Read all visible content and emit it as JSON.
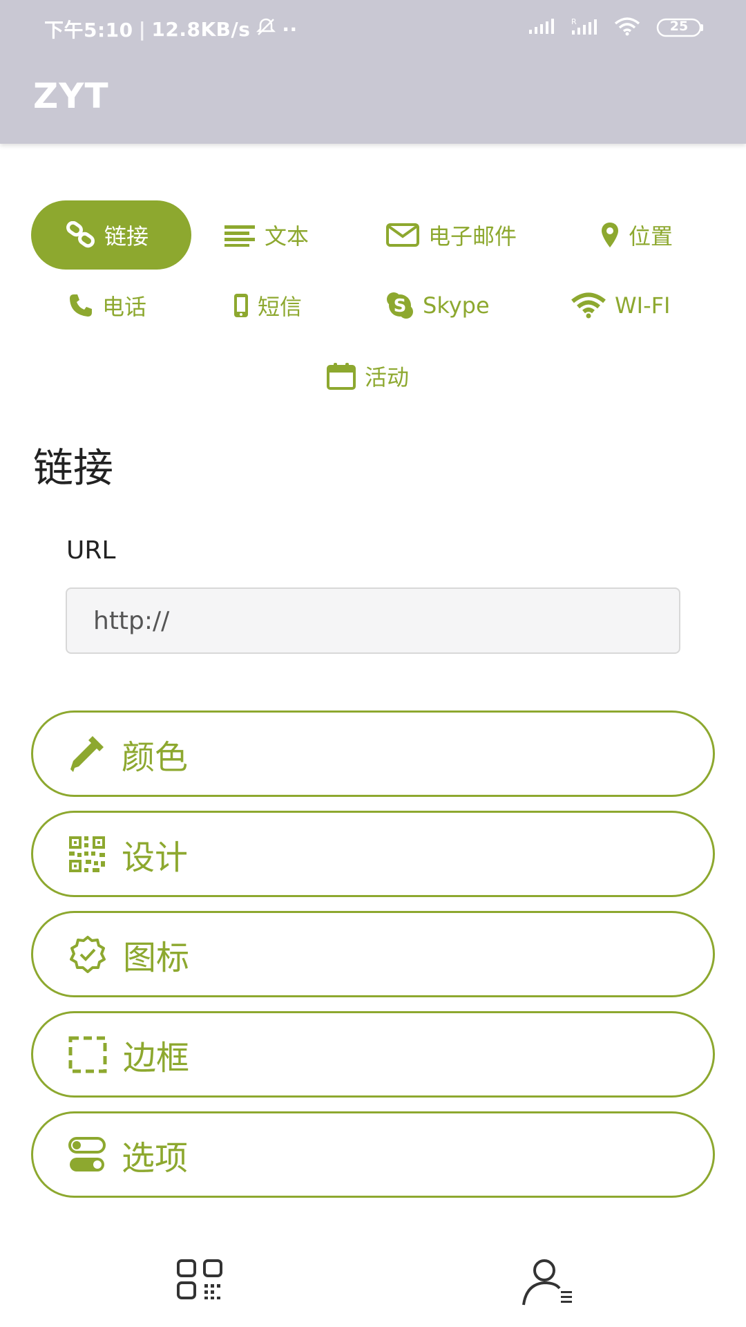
{
  "status_bar": {
    "time": "下午5:10",
    "speed": "12.8KB/s",
    "dots": "··",
    "battery": "25"
  },
  "app": {
    "title": "ZYT"
  },
  "types": [
    {
      "label": "链接",
      "icon": "link-icon",
      "active": true
    },
    {
      "label": "文本",
      "icon": "text-lines-icon"
    },
    {
      "label": "电子邮件",
      "icon": "envelope-icon"
    },
    {
      "label": "位置",
      "icon": "map-pin-icon"
    },
    {
      "label": "电话",
      "icon": "phone-icon"
    },
    {
      "label": "短信",
      "icon": "mobile-icon"
    },
    {
      "label": "Skype",
      "icon": "skype-icon"
    },
    {
      "label": "WI-FI",
      "icon": "wifi-icon"
    },
    {
      "label": "活动",
      "icon": "calendar-icon"
    }
  ],
  "section": {
    "title": "链接",
    "url_label": "URL",
    "url_placeholder": "http://"
  },
  "options": [
    {
      "label": "颜色",
      "icon": "eyedropper-icon"
    },
    {
      "label": "设计",
      "icon": "qr-code-icon"
    },
    {
      "label": "图标",
      "icon": "badge-check-icon"
    },
    {
      "label": "边框",
      "icon": "dashed-frame-icon"
    },
    {
      "label": "选项",
      "icon": "toggles-icon"
    }
  ],
  "nav": [
    {
      "icon": "qr-grid-icon"
    },
    {
      "icon": "user-list-icon"
    }
  ],
  "colors": {
    "accent": "#8da82f",
    "appbar": "#c9c8d3"
  }
}
